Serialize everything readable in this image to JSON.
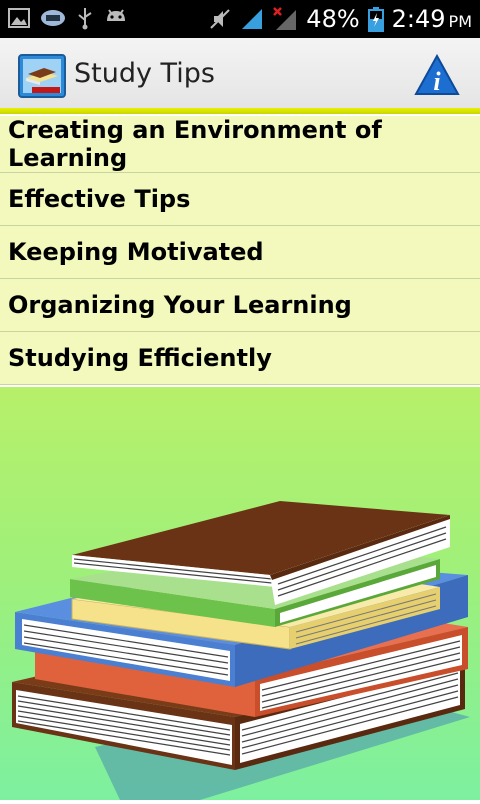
{
  "status_bar": {
    "battery_percent": "48%",
    "time": "2:49",
    "time_suffix": "PM",
    "icons": [
      "gallery-icon",
      "message-icon",
      "usb-icon",
      "android-debug-icon",
      "mute-icon",
      "signal-icon",
      "no-signal-icon",
      "battery-icon"
    ]
  },
  "action_bar": {
    "title": "Study Tips",
    "app_icon": "study-tips-app-icon",
    "info_icon": "info-icon",
    "accent_color": "#e4ec00"
  },
  "topics": [
    {
      "label": "Creating an Environment of Learning"
    },
    {
      "label": "Effective Tips"
    },
    {
      "label": "Keeping Motivated"
    },
    {
      "label": "Organizing Your Learning"
    },
    {
      "label": "Studying Efficiently"
    }
  ],
  "illustration": {
    "name": "stack-of-books",
    "colors": {
      "top_book": "#6b3315",
      "green_book": "#6cc24a",
      "yellow_book": "#f5e28a",
      "blue_book": "#4a7fd1",
      "red_book": "#e0623d",
      "bottom_book": "#6b3315",
      "shadow": "#5fb5a7"
    }
  }
}
